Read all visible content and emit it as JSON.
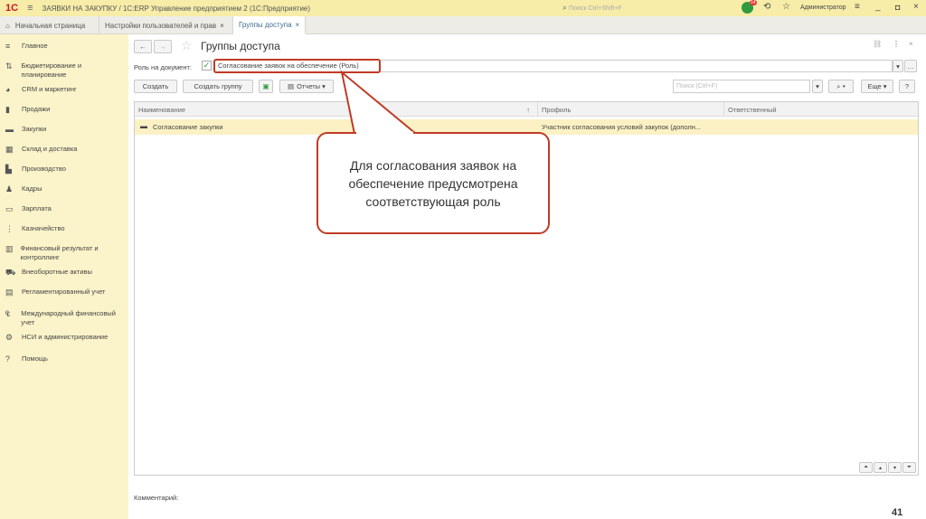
{
  "titlebar": {
    "logo": "1С",
    "title": "ЗАЯВКИ НА ЗАКУПКУ / 1С:ERP Управление предприятием 2  (1С:Предприятие)",
    "search_placeholder": "Поиск Ctrl+Shift+F",
    "notifications": "14",
    "user": "Администратор"
  },
  "tabs": [
    {
      "label": "Начальная страница"
    },
    {
      "label": "Настройки пользователей и прав"
    },
    {
      "label": "Группы доступа"
    }
  ],
  "sidebar": {
    "items": [
      {
        "icon": "menu-icon",
        "glyph": "≡",
        "label": "Главное"
      },
      {
        "icon": "budget-icon",
        "glyph": "⇅",
        "label": "Бюджетирование и планирование"
      },
      {
        "icon": "crm-icon",
        "glyph": "◕",
        "label": "CRM и маркетинг"
      },
      {
        "icon": "sales-icon",
        "glyph": "▮",
        "label": "Продажи"
      },
      {
        "icon": "cart-icon",
        "glyph": "▬",
        "label": "Закупки"
      },
      {
        "icon": "warehouse-icon",
        "glyph": "▦",
        "label": "Склад и доставка"
      },
      {
        "icon": "production-icon",
        "glyph": "▙",
        "label": "Производство"
      },
      {
        "icon": "person-icon",
        "glyph": "♟",
        "label": "Кадры"
      },
      {
        "icon": "salary-icon",
        "glyph": "▭",
        "label": "Зарплата"
      },
      {
        "icon": "treasury-icon",
        "glyph": "⋮",
        "label": "Казначейство"
      },
      {
        "icon": "finance-icon",
        "glyph": "▥",
        "label": "Финансовый результат и контроллинг"
      },
      {
        "icon": "car-icon",
        "glyph": "⛟",
        "label": "Внеоборотные активы"
      },
      {
        "icon": "report-icon",
        "glyph": "▤",
        "label": "Регламентированный учет"
      },
      {
        "icon": "intl-icon",
        "glyph": "₠",
        "label": "Международный финансовый учет"
      },
      {
        "icon": "gear-icon",
        "glyph": "⚙",
        "label": "НСИ и администрирование"
      },
      {
        "icon": "help-icon",
        "glyph": "?",
        "label": "Помощь"
      }
    ]
  },
  "form": {
    "title": "Группы доступа",
    "role_label": "Роль на документ:",
    "role_value": "Согласование заявок на обеспечение (Роль)",
    "create": "Создать",
    "create_group": "Создать группу",
    "reports": "Отчеты",
    "search_placeholder": "Поиск (Ctrl+F)",
    "more": "Еще",
    "help": "?",
    "comment_label": "Комментарий:"
  },
  "table": {
    "columns": [
      "Наименование",
      "Профиль",
      "Ответственный"
    ],
    "rows": [
      {
        "name": "Согласование закупки",
        "profile": "Участник согласования условий закупок (дополн...",
        "responsible": ""
      }
    ]
  },
  "callout": {
    "text": "Для согласования заявок на обеспечение предусмотрена соответствующая роль"
  },
  "slide_number": "41"
}
